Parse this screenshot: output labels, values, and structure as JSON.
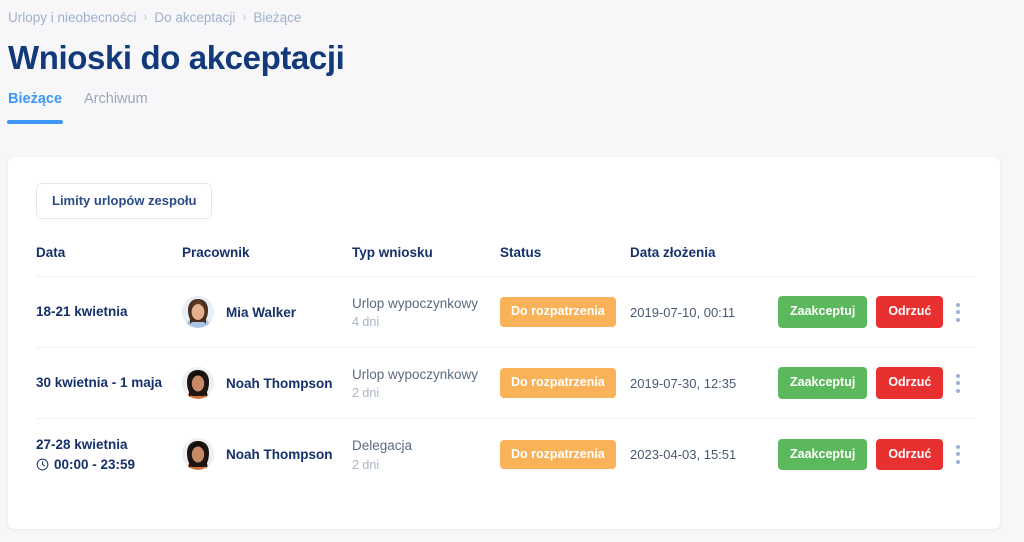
{
  "breadcrumb": {
    "separator": "›",
    "items": [
      {
        "label": "Urlopy i nieobecności"
      },
      {
        "label": "Do akceptacji"
      },
      {
        "label": "Bieżące"
      }
    ]
  },
  "header": {
    "title": "Wnioski do akceptacji"
  },
  "tabs": [
    {
      "label": "Bieżące",
      "active": true
    },
    {
      "label": "Archiwum",
      "active": false
    }
  ],
  "toolbar": {
    "limits_label": "Limity urlopów zespołu"
  },
  "table": {
    "columns": [
      {
        "label": "Data",
        "sortable": true
      },
      {
        "label": "Pracownik",
        "sortable": true
      },
      {
        "label": "Typ wniosku",
        "sortable": false
      },
      {
        "label": "Status",
        "sortable": false
      },
      {
        "label": "Data złożenia",
        "sortable": false
      }
    ],
    "rows": [
      {
        "date": "18-21 kwietnia",
        "time": "",
        "employee": "Mia Walker",
        "avatar": "avatar-mia-walker",
        "type": "Urlop wypoczynkowy",
        "days": "4 dni",
        "status": "Do rozpatrzenia",
        "submitted": "2019-07-10, 00:11",
        "accept_label": "Zaakceptuj",
        "reject_label": "Odrzuć"
      },
      {
        "date": "30 kwietnia - 1 maja",
        "time": "",
        "employee": "Noah Thompson",
        "avatar": "avatar-noah-thompson",
        "type": "Urlop wypoczynkowy",
        "days": "2 dni",
        "status": "Do rozpatrzenia",
        "submitted": "2019-07-30, 12:35",
        "accept_label": "Zaakceptuj",
        "reject_label": "Odrzuć"
      },
      {
        "date": "27-28 kwietnia",
        "time": "00:00 - 23:59",
        "employee": "Noah Thompson",
        "avatar": "avatar-noah-thompson",
        "type": "Delegacja",
        "days": "2 dni",
        "status": "Do rozpatrzenia",
        "submitted": "2023-04-03, 15:51",
        "accept_label": "Zaakceptuj",
        "reject_label": "Odrzuć"
      }
    ]
  },
  "colors": {
    "accent_blue": "#3d97f7",
    "title_navy": "#123a7a",
    "status_orange": "#f9b257",
    "accept_green": "#5cb85c",
    "reject_red": "#e83030",
    "page_bg": "#f7f7f9"
  }
}
